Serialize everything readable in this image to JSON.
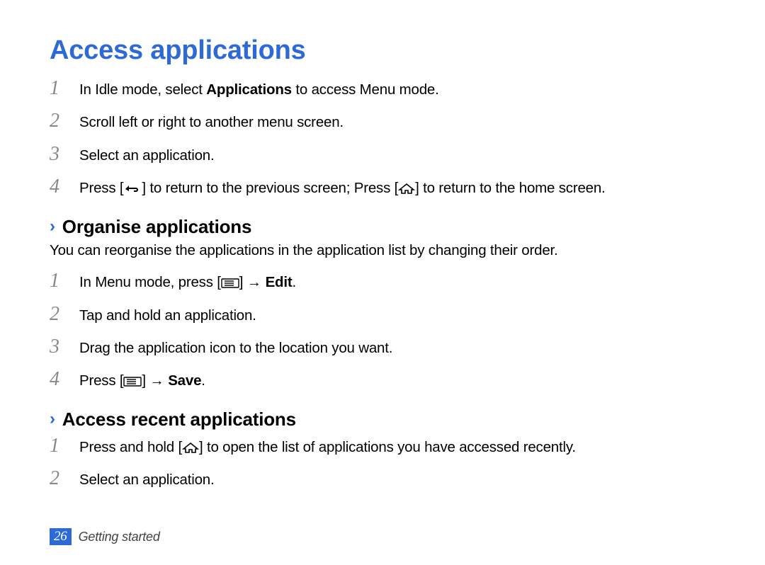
{
  "title": "Access applications",
  "main_steps": [
    {
      "n": "1",
      "pre": "In Idle mode, select ",
      "bold": "Applications",
      "post": " to access Menu mode."
    },
    {
      "n": "2",
      "pre": "Scroll left or right to another menu screen.",
      "bold": "",
      "post": ""
    },
    {
      "n": "3",
      "pre": "Select an application.",
      "bold": "",
      "post": ""
    },
    {
      "n": "4",
      "pre": "Press [",
      "icon": "back",
      "mid": "] to return to the previous screen; Press [",
      "icon2": "home",
      "post": "] to return to the home screen."
    }
  ],
  "organise": {
    "heading": "Organise applications",
    "intro": "You can reorganise the applications in the application list by changing their order.",
    "steps": [
      {
        "n": "1",
        "pre": "In Menu mode, press [",
        "icon": "menu",
        "mid": "] → ",
        "bold": "Edit",
        "post": "."
      },
      {
        "n": "2",
        "pre": "Tap and hold an application.",
        "bold": "",
        "post": ""
      },
      {
        "n": "3",
        "pre": "Drag the application icon to the location you want.",
        "bold": "",
        "post": ""
      },
      {
        "n": "4",
        "pre": "Press [",
        "icon": "menu",
        "mid": "] → ",
        "bold": "Save",
        "post": "."
      }
    ]
  },
  "recent": {
    "heading": "Access recent applications",
    "steps": [
      {
        "n": "1",
        "pre": "Press and hold [",
        "icon": "home",
        "mid": "] to open the list of applications you have accessed recently.",
        "bold": "",
        "post": ""
      },
      {
        "n": "2",
        "pre": "Select an application.",
        "bold": "",
        "post": ""
      }
    ]
  },
  "footer": {
    "page": "26",
    "section": "Getting started"
  }
}
